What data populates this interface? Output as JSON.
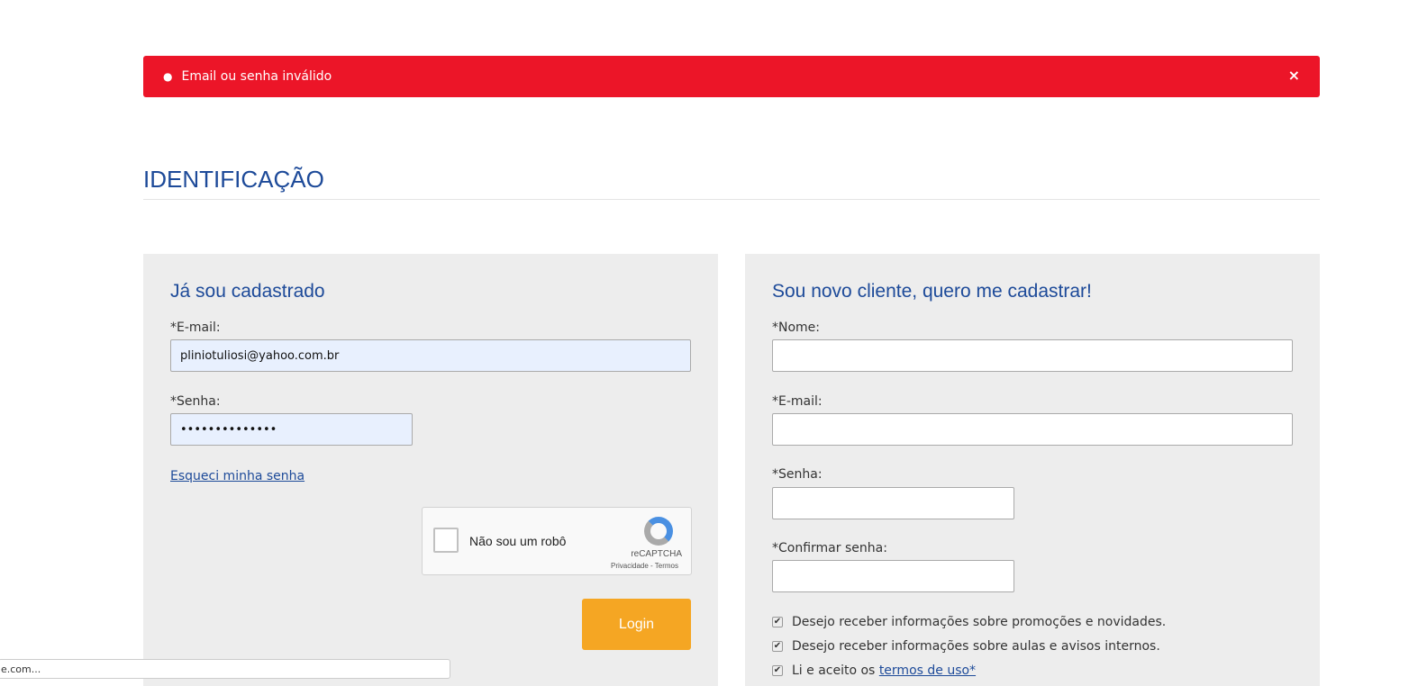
{
  "alert": {
    "message": "Email ou senha inválido",
    "close": "×"
  },
  "page_title": "IDENTIFICAÇÃO",
  "login": {
    "heading": "Já sou cadastrado",
    "email_label": "*E-mail:",
    "email_value": "pliniotuliosi@yahoo.com.br",
    "password_label": "*Senha:",
    "password_value": "••••••••••••••",
    "forgot": "Esqueci minha senha",
    "captcha_text": "Não sou um robô",
    "captcha_brand": "reCAPTCHA",
    "captcha_terms": "Privacidade - Termos",
    "button": "Login"
  },
  "register": {
    "heading": "Sou novo cliente, quero me cadastrar!",
    "name_label": "*Nome:",
    "email_label": "*E-mail:",
    "password_label": "*Senha:",
    "confirm_label": "*Confirmar senha:",
    "opt1": "Desejo receber informações sobre promoções e novidades.",
    "opt2": "Desejo receber informações sobre aulas e avisos internos.",
    "terms_prefix": "Li e aceito os ",
    "terms_link": "termos de uso*"
  },
  "status_bar": "e.com..."
}
